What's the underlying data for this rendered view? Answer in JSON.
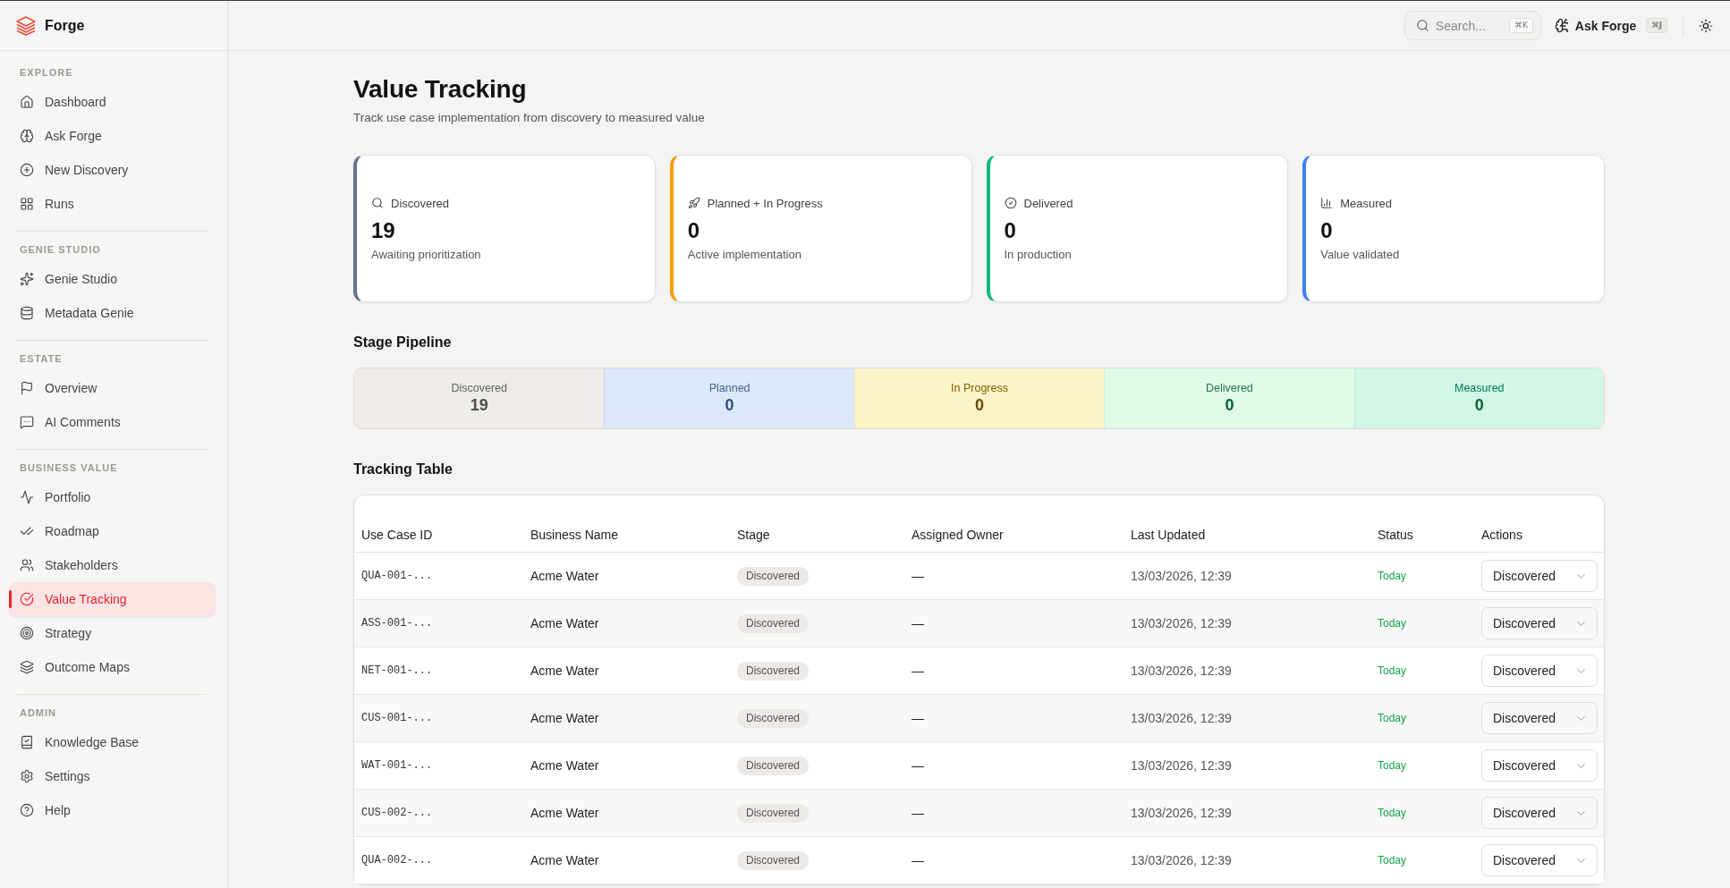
{
  "app": {
    "name": "Forge"
  },
  "sidebar": {
    "sections": [
      {
        "heading": "EXPLORE",
        "items": [
          {
            "label": "Dashboard",
            "selected": false
          },
          {
            "label": "Ask Forge",
            "selected": false
          },
          {
            "label": "New Discovery",
            "selected": false
          },
          {
            "label": "Runs",
            "selected": false
          }
        ]
      },
      {
        "heading": "GENIE STUDIO",
        "items": [
          {
            "label": "Genie Studio",
            "selected": false
          },
          {
            "label": "Metadata Genie",
            "selected": false
          }
        ]
      },
      {
        "heading": "ESTATE",
        "items": [
          {
            "label": "Overview",
            "selected": false
          },
          {
            "label": "AI Comments",
            "selected": false
          }
        ]
      },
      {
        "heading": "BUSINESS VALUE",
        "items": [
          {
            "label": "Portfolio",
            "selected": false
          },
          {
            "label": "Roadmap",
            "selected": false
          },
          {
            "label": "Stakeholders",
            "selected": false
          },
          {
            "label": "Value Tracking",
            "selected": true
          },
          {
            "label": "Strategy",
            "selected": false
          },
          {
            "label": "Outcome Maps",
            "selected": false
          }
        ]
      },
      {
        "heading": "ADMIN",
        "items": [
          {
            "label": "Knowledge Base",
            "selected": false
          },
          {
            "label": "Settings",
            "selected": false
          },
          {
            "label": "Help",
            "selected": false
          }
        ]
      }
    ]
  },
  "topbar": {
    "search": {
      "placeholder": "Search...",
      "shortcut": "⌘K"
    },
    "ask_button": {
      "label": "Ask Forge",
      "shortcut": "⌘J"
    }
  },
  "page": {
    "title": "Value Tracking",
    "subtitle": "Track use case implementation from discovery to measured value"
  },
  "summary_cards": [
    {
      "label": "Discovered",
      "value": "19",
      "caption": "Awaiting prioritization",
      "color": "#64748b"
    },
    {
      "label": "Planned + In Progress",
      "value": "0",
      "caption": "Active implementation",
      "color": "#f59e0b"
    },
    {
      "label": "Delivered",
      "value": "0",
      "caption": "In production",
      "color": "#10b981"
    },
    {
      "label": "Measured",
      "value": "0",
      "caption": "Value validated",
      "color": "#3b82f6"
    }
  ],
  "pipeline": {
    "title": "Stage Pipeline",
    "stages": [
      {
        "label": "Discovered",
        "value": "19",
        "color": "#eeebe8"
      },
      {
        "label": "Planned",
        "value": "0",
        "color": "#dce8fb"
      },
      {
        "label": "In Progress",
        "value": "0",
        "color": "#fcf3c9"
      },
      {
        "label": "Delivered",
        "value": "0",
        "color": "#dffbe8"
      },
      {
        "label": "Measured",
        "value": "0",
        "color": "#d2f7e4"
      }
    ]
  },
  "tracking_table": {
    "title": "Tracking Table",
    "columns": [
      "Use Case ID",
      "Business Name",
      "Stage",
      "Assigned Owner",
      "Last Updated",
      "Status",
      "Actions"
    ],
    "rows": [
      {
        "use_case_id": "QUA-001-...",
        "business_name": "Acme Water",
        "stage": "Discovered",
        "assigned_owner": "—",
        "last_updated": "13/03/2026, 12:39",
        "status": "Today",
        "action": "Discovered"
      },
      {
        "use_case_id": "ASS-001-...",
        "business_name": "Acme Water",
        "stage": "Discovered",
        "assigned_owner": "—",
        "last_updated": "13/03/2026, 12:39",
        "status": "Today",
        "action": "Discovered"
      },
      {
        "use_case_id": "NET-001-...",
        "business_name": "Acme Water",
        "stage": "Discovered",
        "assigned_owner": "—",
        "last_updated": "13/03/2026, 12:39",
        "status": "Today",
        "action": "Discovered"
      },
      {
        "use_case_id": "CUS-001-...",
        "business_name": "Acme Water",
        "stage": "Discovered",
        "assigned_owner": "—",
        "last_updated": "13/03/2026, 12:39",
        "status": "Today",
        "action": "Discovered"
      },
      {
        "use_case_id": "WAT-001-...",
        "business_name": "Acme Water",
        "stage": "Discovered",
        "assigned_owner": "—",
        "last_updated": "13/03/2026, 12:39",
        "status": "Today",
        "action": "Discovered"
      },
      {
        "use_case_id": "CUS-002-...",
        "business_name": "Acme Water",
        "stage": "Discovered",
        "assigned_owner": "—",
        "last_updated": "13/03/2026, 12:39",
        "status": "Today",
        "action": "Discovered"
      },
      {
        "use_case_id": "QUA-002-...",
        "business_name": "Acme Water",
        "stage": "Discovered",
        "assigned_owner": "—",
        "last_updated": "13/03/2026, 12:39",
        "status": "Today",
        "action": "Discovered"
      }
    ]
  }
}
